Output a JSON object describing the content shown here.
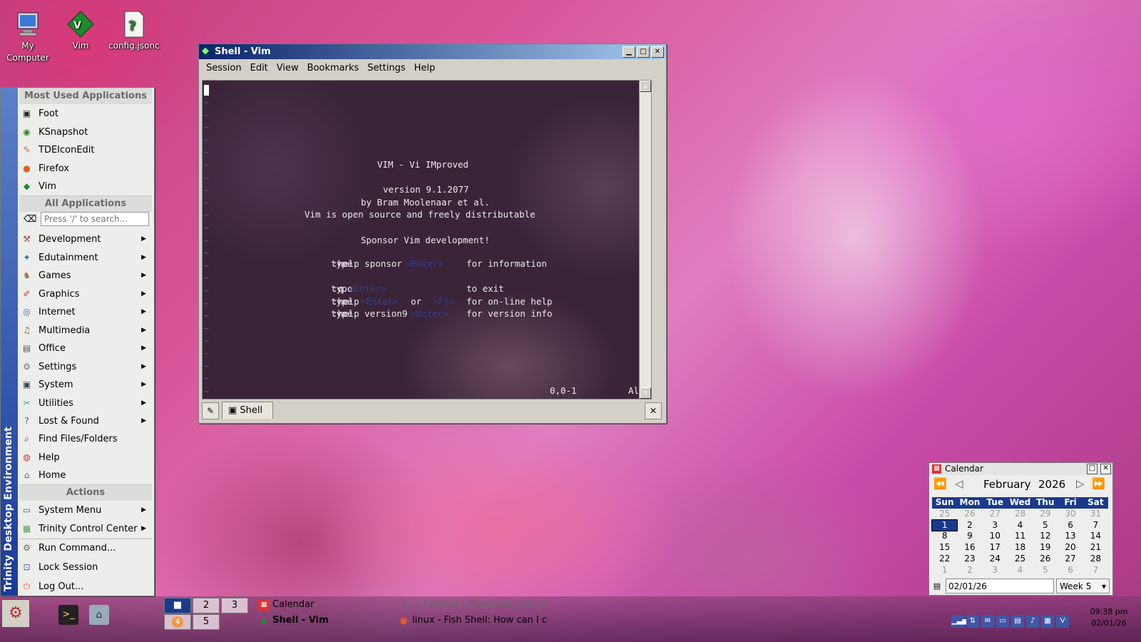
{
  "desktop": {
    "icons": [
      {
        "label": "My Computer"
      },
      {
        "label": "Vim"
      },
      {
        "label": "config.jsonc"
      }
    ]
  },
  "window": {
    "title": "Shell - Vim",
    "menu": [
      "Session",
      "Edit",
      "View",
      "Bookmarks",
      "Settings",
      "Help"
    ],
    "vim": {
      "lines": [
        "VIM - Vi IMproved",
        "version 9.1.2077",
        "by Bram Moolenaar et al.",
        "Vim is open source and freely distributable",
        "Sponsor Vim development!"
      ],
      "help": [
        {
          "type": "type",
          "cmd": ":help sponsor",
          "key": "<Enter>",
          "mid": "",
          "key2": "",
          "desc": "for information"
        },
        {
          "type": "type",
          "cmd": ":q",
          "key": "<Enter>",
          "mid": "",
          "key2": "",
          "desc": "to exit"
        },
        {
          "type": "type",
          "cmd": ":help",
          "key": "<Enter>",
          "mid": "or",
          "key2": "<F1>",
          "desc": "for on-line help"
        },
        {
          "type": "type",
          "cmd": ":help version9",
          "key": "<Enter>",
          "mid": "",
          "key2": "",
          "desc": "for version info"
        }
      ],
      "tilde": "~",
      "status_pos": "0,0-1",
      "status_all": "All"
    },
    "tab_label": "Shell"
  },
  "start_menu": {
    "sidebar_text": "Trinity Desktop Environment",
    "most_used_header": "Most Used Applications",
    "most_used": [
      {
        "label": "Foot",
        "icon": "terminal-icon"
      },
      {
        "label": "KSnapshot",
        "icon": "camera-icon"
      },
      {
        "label": "TDEIconEdit",
        "icon": "paint-icon"
      },
      {
        "label": "Firefox",
        "icon": "firefox-icon"
      },
      {
        "label": "Vim",
        "icon": "vim-icon"
      }
    ],
    "all_apps_header": "All Applications",
    "search_placeholder": "Press '/' to search...",
    "categories": [
      {
        "label": "Development",
        "icon": "development-icon"
      },
      {
        "label": "Edutainment",
        "icon": "edutainment-icon"
      },
      {
        "label": "Games",
        "icon": "games-icon"
      },
      {
        "label": "Graphics",
        "icon": "graphics-icon"
      },
      {
        "label": "Internet",
        "icon": "internet-icon"
      },
      {
        "label": "Multimedia",
        "icon": "multimedia-icon"
      },
      {
        "label": "Office",
        "icon": "office-icon"
      },
      {
        "label": "Settings",
        "icon": "settings-icon"
      },
      {
        "label": "System",
        "icon": "system-icon"
      },
      {
        "label": "Utilities",
        "icon": "utilities-icon"
      },
      {
        "label": "Lost & Found",
        "icon": "lost-found-icon"
      }
    ],
    "extra_items": [
      {
        "label": "Find Files/Folders",
        "icon": "find-icon"
      },
      {
        "label": "Help",
        "icon": "help-icon"
      },
      {
        "label": "Home",
        "icon": "home-icon"
      }
    ],
    "actions_header": "Actions",
    "actions": [
      {
        "label": "System Menu",
        "icon": "system-menu-icon"
      },
      {
        "label": "Trinity Control Center",
        "icon": "control-center-icon"
      }
    ],
    "bottom": [
      {
        "label": "Run Command...",
        "icon": "run-icon"
      },
      {
        "label": "Lock Session",
        "icon": "lock-icon"
      },
      {
        "label": "Log Out...",
        "icon": "logout-icon"
      }
    ]
  },
  "calendar": {
    "title": "Calendar",
    "month": "February",
    "year": "2026",
    "weekdays": [
      "Sun",
      "Mon",
      "Tue",
      "Wed",
      "Thu",
      "Fri",
      "Sat"
    ],
    "weeks": [
      [
        "25",
        "26",
        "27",
        "28",
        "29",
        "30",
        "31"
      ],
      [
        "1",
        "2",
        "3",
        "4",
        "5",
        "6",
        "7"
      ],
      [
        "8",
        "9",
        "10",
        "11",
        "12",
        "13",
        "14"
      ],
      [
        "15",
        "16",
        "17",
        "18",
        "19",
        "20",
        "21"
      ],
      [
        "22",
        "23",
        "24",
        "25",
        "26",
        "27",
        "28"
      ],
      [
        "1",
        "2",
        "3",
        "4",
        "5",
        "6",
        "7"
      ]
    ],
    "selected": "1",
    "date_field": "02/01/26",
    "week_field": "Week 5"
  },
  "taskbar": {
    "desktops": [
      "2",
      "3",
      "5"
    ],
    "badge": "4",
    "tasks": [
      {
        "label": "Calendar"
      },
      {
        "label": "Shell - Vim"
      },
      {
        "label": "• Discord | @deleted_user_c"
      },
      {
        "label": "linux - Fish Shell: How can I c"
      }
    ],
    "clock_time": "09:38 pm",
    "clock_date": "02/01/26"
  },
  "colors": {
    "accent": "#1a3a8c",
    "title_start": "#0a246a",
    "title_end": "#a6caf0",
    "vim_tilde": "#4d66c8"
  }
}
